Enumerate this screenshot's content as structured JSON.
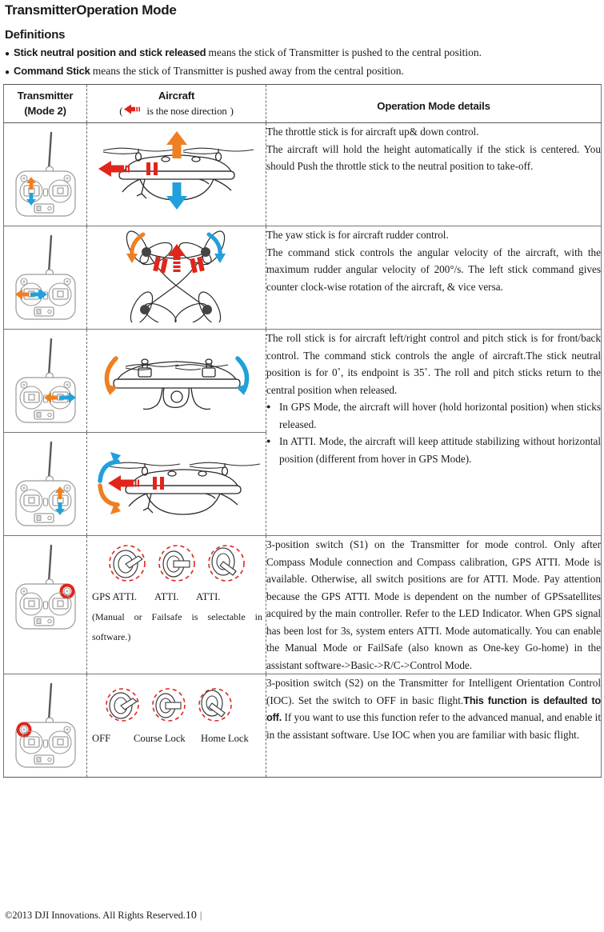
{
  "document": {
    "title": "TransmitterOperation Mode",
    "section_heading": "Definitions",
    "definitions": [
      {
        "term": "Stick neutral position and stick released",
        "text": "means the stick of Transmitter is pushed to the central position."
      },
      {
        "term": "Command Stick",
        "text": "means the stick of Transmitter is pushed away from the central position."
      }
    ],
    "footer": {
      "copyright": "©2013 DJI Innovations. All Rights Reserved.",
      "page_number": "10",
      "bar": "|"
    }
  },
  "table": {
    "headers": {
      "transmitter": "Transmitter",
      "transmitter_sub": "(Mode 2)",
      "aircraft": "Aircraft",
      "aircraft_sub_open": "(",
      "aircraft_sub_text": "is the nose direction",
      "aircraft_sub_close": ")",
      "details": "Operation Mode details"
    },
    "rows": [
      {
        "id": "throttle",
        "transmitter_icon": "transmitter-left-stick-vertical",
        "aircraft_icon": "aircraft-side-view-up-down",
        "details": [
          "The throttle stick is for aircraft up& down control.",
          "The aircraft will hold the height automatically if the stick is centered. You should Push the throttle stick to the neutral position to take-off."
        ]
      },
      {
        "id": "yaw",
        "transmitter_icon": "transmitter-left-stick-horizontal",
        "aircraft_icon": "aircraft-top-view-yaw",
        "details": [
          "The yaw stick is for aircraft rudder control.",
          "The command stick controls the angular velocity of the aircraft, with the maximum rudder angular velocity of 200°/s. The left stick command gives counter clock-wise rotation of the aircraft, & vice versa."
        ]
      },
      {
        "id": "roll",
        "transmitter_icon": "transmitter-right-stick-horizontal",
        "aircraft_icon": "aircraft-front-view-roll",
        "details": [
          "The roll stick is for aircraft left/right control and pitch stick is for front/back control. The command stick controls the angle of aircraft.The stick neutral position is for 0˚, its endpoint is 35˚. The roll and pitch sticks return to the central position when released."
        ]
      },
      {
        "id": "pitch",
        "transmitter_icon": "transmitter-right-stick-vertical",
        "aircraft_icon": "aircraft-side-view-pitch",
        "bullets": [
          "In GPS Mode, the aircraft will hover (hold horizontal position) when sticks released.",
          "In ATTI. Mode, the aircraft will keep attitude stabilizing without horizontal position (different from hover in GPS Mode)."
        ]
      },
      {
        "id": "s1-mode-switch",
        "transmitter_icon": "transmitter-s1-switch-highlight",
        "switch_icons": [
          "switch-position-left",
          "switch-position-center",
          "switch-position-right"
        ],
        "switch_labels": [
          "GPS ATTI.",
          "ATTI.",
          "ATTI."
        ],
        "switch_note": "(Manual or Failsafe is selectable in software.)",
        "details": [
          "3-position switch (S1) on the Transmitter for mode control. Only after Compass Module connection and Compass calibration, GPS ATTI. Mode is available. Otherwise, all switch positions are for ATTI. Mode. Pay attention because the GPS ATTI. Mode is dependent on the number of GPSsatellites acquired by the main controller. Refer to the LED Indicator. When GPS signal has been lost for 3s, system enters ATTI. Mode automatically. You can enable the Manual Mode or FailSafe (also known as One-key Go-home) in the assistant software->Basic->R/C->Control Mode."
        ]
      },
      {
        "id": "s2-ioc-switch",
        "transmitter_icon": "transmitter-s2-switch-highlight",
        "switch_icons": [
          "switch-position-left",
          "switch-position-center",
          "switch-position-right"
        ],
        "switch_labels": [
          "OFF",
          "Course Lock",
          "Home Lock"
        ],
        "details_pre": "3-position switch (S2) on the Transmitter for Intelligent Orientation Control (IOC). Set the switch to OFF in basic flight.",
        "details_bold": "This function is defaulted to off.",
        "details_post": " If you want to use this function refer to the advanced manual, and enable it in the assistant software. Use IOC when you are familiar with basic flight."
      }
    ]
  },
  "colors": {
    "accent_orange": "#EE7F22",
    "accent_blue": "#21A0DC",
    "accent_red": "#E1251B",
    "line_gray": "#777777",
    "text": "#1a1a1a"
  }
}
